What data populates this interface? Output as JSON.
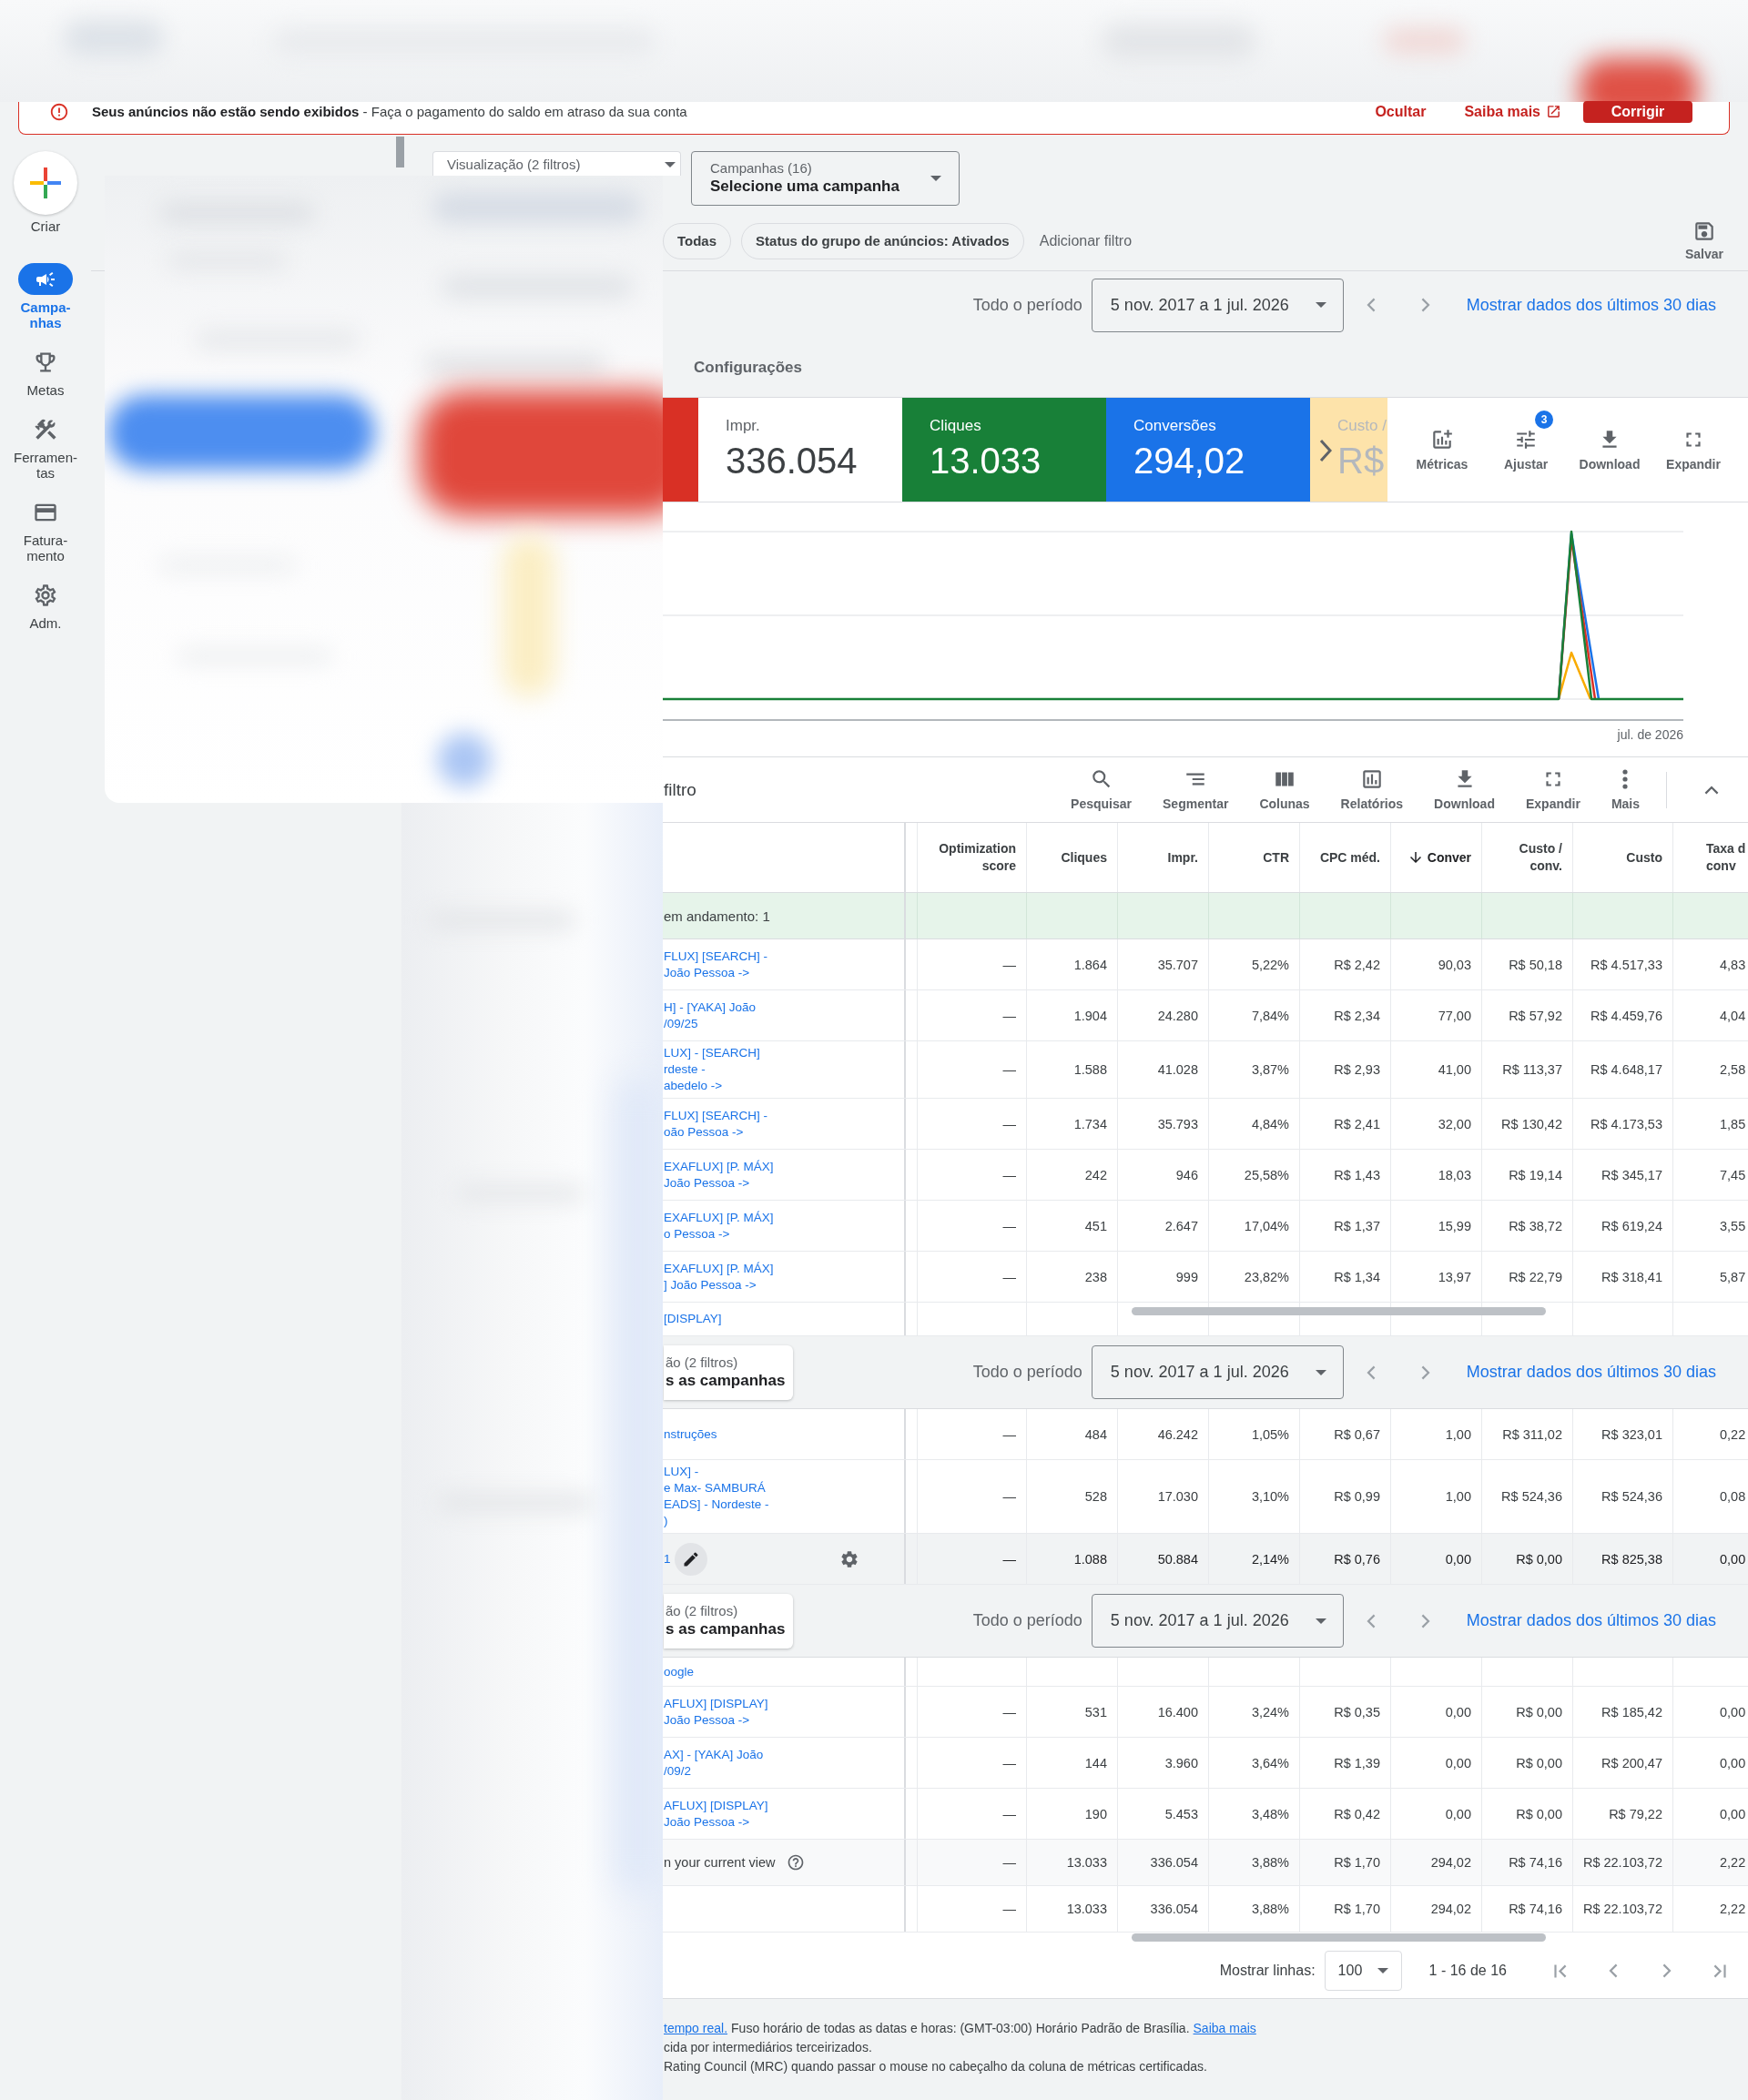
{
  "banner": {
    "message": "**Seus anúncios não estão sendo exibidos** - Faça o pagamento do saldo em atraso da sua conta",
    "actions": [
      {
        "kind": "link",
        "label": "Ocultar"
      },
      {
        "kind": "external_link",
        "label": "Saiba mais"
      },
      {
        "kind": "button",
        "label": "Corrigir"
      }
    ]
  },
  "create_button": {
    "label": "Criar"
  },
  "nav": [
    {
      "kind": "campaigns",
      "label": "Campa-nhas",
      "selected": true
    },
    {
      "kind": "goals",
      "label": "Metas",
      "selected": false
    },
    {
      "kind": "tools",
      "label": "Ferramen-tas",
      "selected": false
    },
    {
      "kind": "billing",
      "label": "Fatura-mento",
      "selected": false
    },
    {
      "kind": "admin",
      "label": "Adm.",
      "selected": false
    }
  ],
  "filters": {
    "view_dropdown": {
      "label": "Visualização (2 filtros)"
    },
    "campaign_dropdown": {
      "label": "Campanhas (16)",
      "value": "Selecione uma campanha"
    },
    "chips": [
      "Todas",
      "Status do grupo de anúncios: Ativados"
    ],
    "add_filter": "Adicionar filtro",
    "save": "Salvar"
  },
  "date_bar": {
    "label": "Todo o período",
    "range": "5 nov. 2017 a 1 jul. 2026",
    "link": "Mostrar dados dos últimos 30 dias"
  },
  "section_tab": "Configurações",
  "metrics": [
    {
      "selected": true,
      "faded": false,
      "color": "#d93025"
    },
    {
      "label": "Impr.",
      "value": "336.054",
      "selected": false,
      "faded": false
    },
    {
      "label": "Cliques",
      "value": "13.033",
      "selected": true,
      "faded": false,
      "color": "#188038"
    },
    {
      "label": "Conversões",
      "value": "294,02",
      "selected": true,
      "faded": false,
      "color": "#1a73e8"
    },
    {
      "label": "Custo /",
      "value": "R$",
      "selected": true,
      "faded": true,
      "color": "#f9ab00"
    }
  ],
  "metric_tools": [
    {
      "kind": "metrics",
      "label": "Métricas"
    },
    {
      "kind": "adjust",
      "label": "Ajustar",
      "badge": "3"
    },
    {
      "kind": "download",
      "label": "Download"
    },
    {
      "kind": "expand",
      "label": "Expandir"
    }
  ],
  "chart": {
    "x_label": "jul. de 2026"
  },
  "table": {
    "toolbar": {
      "filter": "filtro",
      "tools": [
        {
          "kind": "search",
          "label": "Pesquisar"
        },
        {
          "kind": "segment",
          "label": "Segmentar"
        },
        {
          "kind": "columns",
          "label": "Colunas"
        },
        {
          "kind": "reports",
          "label": "Relatórios"
        },
        {
          "kind": "download",
          "label": "Download"
        },
        {
          "kind": "expand",
          "label": "Expandir"
        },
        {
          "kind": "more",
          "label": "Mais"
        }
      ]
    },
    "columns": [
      {
        "label": "Optimization\nscore",
        "sorted": false
      },
      {
        "label": "Cliques",
        "sorted": false
      },
      {
        "label": "Impr.",
        "sorted": false
      },
      {
        "label": "CTR",
        "sorted": false
      },
      {
        "label": "CPC méd.",
        "sorted": false
      },
      {
        "label": "Conver",
        "sorted": true
      },
      {
        "label": "Custo /\nconv.",
        "sorted": false
      },
      {
        "label": "Custo",
        "sorted": false
      },
      {
        "label": "Taxa d\nconv",
        "sorted": false
      }
    ],
    "rows": [
      {
        "kind": "group",
        "name": "em andamento: 1"
      },
      {
        "kind": "row",
        "hovered": false,
        "name": "FLUX] [SEARCH] -\nJoão Pessoa ->",
        "cells": [
          "—",
          "1.864",
          "35.707",
          "5,22%",
          "R$ 2,42",
          "90,03",
          "R$ 50,18",
          "R$ 4.517,33",
          "4,83"
        ]
      },
      {
        "kind": "row",
        "hovered": false,
        "name": "H] - [YAKA] João\n/09/25",
        "cells": [
          "—",
          "1.904",
          "24.280",
          "7,84%",
          "R$ 2,34",
          "77,00",
          "R$ 57,92",
          "R$ 4.459,76",
          "4,04"
        ]
      },
      {
        "kind": "row",
        "hovered": false,
        "name": "LUX] - [SEARCH]\nrdeste -\nabedelo ->",
        "cells": [
          "—",
          "1.588",
          "41.028",
          "3,87%",
          "R$ 2,93",
          "41,00",
          "R$ 113,37",
          "R$ 4.648,17",
          "2,58"
        ]
      },
      {
        "kind": "row",
        "hovered": false,
        "name": "FLUX] [SEARCH] -\noão Pessoa ->",
        "cells": [
          "—",
          "1.734",
          "35.793",
          "4,84%",
          "R$ 2,41",
          "32,00",
          "R$ 130,42",
          "R$ 4.173,53",
          "1,85"
        ]
      },
      {
        "kind": "row",
        "hovered": false,
        "name": "EXAFLUX] [P. MÁX]\nJoão Pessoa ->",
        "cells": [
          "—",
          "242",
          "946",
          "25,58%",
          "R$ 1,43",
          "18,03",
          "R$ 19,14",
          "R$ 345,17",
          "7,45"
        ]
      },
      {
        "kind": "row",
        "hovered": false,
        "name": "EXAFLUX] [P. MÁX]\no Pessoa ->",
        "cells": [
          "—",
          "451",
          "2.647",
          "17,04%",
          "R$ 1,37",
          "15,99",
          "R$ 38,72",
          "R$ 619,24",
          "3,55"
        ]
      },
      {
        "kind": "row",
        "hovered": false,
        "name": "EXAFLUX] [P. MÁX]\n] João Pessoa ->",
        "cells": [
          "—",
          "238",
          "999",
          "23,82%",
          "R$ 1,34",
          "13,97",
          "R$ 22,79",
          "R$ 318,41",
          "5,87"
        ]
      },
      {
        "kind": "partial",
        "name": "[DISPLAY]"
      },
      {
        "kind": "date_bar",
        "dropdown_label": "ão (2 filtros)",
        "dropdown_value": "s as campanhas",
        "label": "Todo o período",
        "range": "5 nov. 2017 a 1 jul. 2026",
        "link": "Mostrar dados dos últimos 30 dias"
      },
      {
        "kind": "row",
        "hovered": false,
        "name": "nstruções",
        "cells": [
          "—",
          "484",
          "46.242",
          "1,05%",
          "R$ 0,67",
          "1,00",
          "R$ 311,02",
          "R$ 323,01",
          "0,22"
        ]
      },
      {
        "kind": "row",
        "hovered": false,
        "name": "LUX] -\ne Max- SAMBURÁ\nEADS] - Nordeste -\n)",
        "cells": [
          "—",
          "528",
          "17.030",
          "3,10%",
          "R$ 0,99",
          "1,00",
          "R$ 524,36",
          "R$ 524,36",
          "0,08"
        ]
      },
      {
        "kind": "row",
        "hovered": true,
        "name": "1",
        "cells": [
          "—",
          "1.088",
          "50.884",
          "2,14%",
          "R$ 0,76",
          "0,00",
          "R$ 0,00",
          "R$ 825,38",
          "0,00"
        ]
      },
      {
        "kind": "date_bar",
        "dropdown_label": "ão (2 filtros)",
        "dropdown_value": "s as campanhas",
        "label": "Todo o período",
        "range": "5 nov. 2017 a 1 jul. 2026",
        "link": "Mostrar dados dos últimos 30 dias"
      },
      {
        "kind": "partial",
        "name": "oogle"
      },
      {
        "kind": "row",
        "hovered": false,
        "name": "AFLUX] [DISPLAY]\nJoão Pessoa ->",
        "cells": [
          "—",
          "531",
          "16.400",
          "3,24%",
          "R$ 0,35",
          "0,00",
          "R$ 0,00",
          "R$ 185,42",
          "0,00"
        ]
      },
      {
        "kind": "row",
        "hovered": false,
        "name": "AX] - [YAKA] João\n/09/2",
        "cells": [
          "—",
          "144",
          "3.960",
          "3,64%",
          "R$ 1,39",
          "0,00",
          "R$ 0,00",
          "R$ 200,47",
          "0,00"
        ]
      },
      {
        "kind": "row",
        "hovered": false,
        "name": "AFLUX] [DISPLAY]\nJoão Pessoa ->",
        "cells": [
          "—",
          "190",
          "5.453",
          "3,48%",
          "R$ 0,42",
          "0,00",
          "R$ 0,00",
          "R$ 79,22",
          "0,00"
        ]
      },
      {
        "kind": "total",
        "shaded": true,
        "help": true,
        "name": "n your current view",
        "cells": [
          "—",
          "13.033",
          "336.054",
          "3,88%",
          "R$ 1,70",
          "294,02",
          "R$ 74,16",
          "R$ 22.103,72",
          "2,22"
        ]
      },
      {
        "kind": "total",
        "shaded": false,
        "help": false,
        "cells": [
          "—",
          "13.033",
          "336.054",
          "3,88%",
          "R$ 1,70",
          "294,02",
          "R$ 74,16",
          "R$ 22.103,72",
          "2,22"
        ]
      }
    ]
  },
  "pagination": {
    "label": "Mostrar linhas:",
    "value": "100",
    "range": "1 - 16 de 16"
  },
  "footer": [
    {
      "parts": [
        {
          "kind": "link",
          "text": "tempo real."
        },
        {
          "kind": "text",
          "text": "Fuso horário de todas as datas e horas: (GMT-03:00) Horário Padrão de Brasília."
        },
        {
          "kind": "link",
          "text": "Saiba mais"
        }
      ]
    },
    {
      "parts": [
        {
          "kind": "text",
          "text": "cida por intermediários terceirizados."
        }
      ]
    },
    {
      "parts": [
        {
          "kind": "text",
          "text": "Rating Council (MRC) quando passar o mouse no cabeçalho da coluna de métricas certificadas."
        }
      ]
    }
  ]
}
